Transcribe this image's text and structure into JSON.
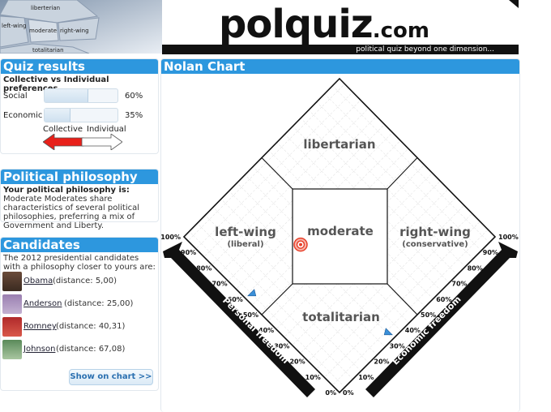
{
  "header": {
    "thumb_labels": [
      "liberterian",
      "left-wing",
      "moderate",
      "right-wing",
      "totalitarian"
    ],
    "brand_main": "polquiz",
    "brand_suffix": ".com",
    "tagline": "political quiz beyond one dimension..."
  },
  "results": {
    "title": "Quiz results",
    "subtitle": "Collective vs Individual preferences",
    "rows": [
      {
        "label": "Social",
        "pct_text": "60%",
        "value": 0.6
      },
      {
        "label": "Economic",
        "pct_text": "35%",
        "value": 0.35
      }
    ],
    "arrow_left_label": "Collective",
    "arrow_right_label": "Individual"
  },
  "philosophy": {
    "title": "Political philosophy",
    "lead": "Your political philosophy is:",
    "value": "Moderate",
    "description": "Moderates share characteristics of several political philosophies, preferring a mix of Government and Liberty."
  },
  "candidates": {
    "title": "Candidates",
    "intro": "The 2012 presidential candidates with a philosophy closer to yours are:",
    "items": [
      {
        "name": "Obama",
        "distance": "(distance: 5,00)"
      },
      {
        "name": "Anderson",
        "distance": "(distance: 25,00)"
      },
      {
        "name": "Romney",
        "distance": "(distance: 40,31)"
      },
      {
        "name": "Johnson",
        "distance": "(distance: 67,08)"
      }
    ],
    "button": "Show on chart >>"
  },
  "nolan": {
    "title": "Nolan Chart",
    "regions": {
      "top": "libertarian",
      "left": "left-wing",
      "left_sub": "(liberal)",
      "center": "moderate",
      "right": "right-wing",
      "right_sub": "(conservative)",
      "bottom": "totalitarian"
    },
    "axis_left": "Personal freedom",
    "axis_right": "Economic freedom",
    "ticks": [
      "0%",
      "10%",
      "20%",
      "30%",
      "40%",
      "50%",
      "60%",
      "70%",
      "80%",
      "90%",
      "100%"
    ],
    "user_economic": 0.35,
    "user_social": 0.6
  },
  "colors": {
    "accent": "#2d97de",
    "arrow_red": "#e8201a",
    "marker": "#e8402a"
  }
}
